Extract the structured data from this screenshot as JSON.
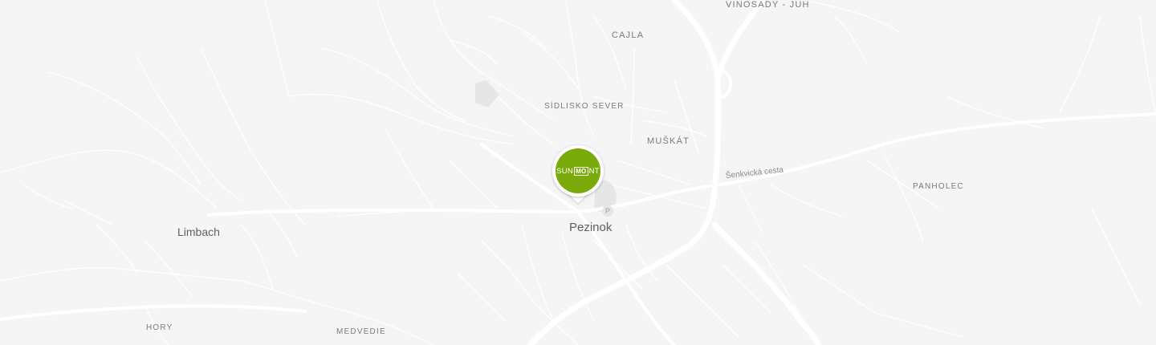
{
  "map": {
    "colors": {
      "background": "#f5f5f5",
      "road": "#ffffff",
      "building": "#e6e6e6",
      "marker": "#7aab0a"
    },
    "labels": {
      "vinosady": "VINOSADY - JUH",
      "cajla": "CAJLA",
      "sidlisko": "SÍDLISKO SEVER",
      "muskat": "MUŠKÁT",
      "pezinok": "Pezinok",
      "limbach": "Limbach",
      "panholec": "PANHOLEC",
      "hory": "HORY",
      "medvedie": "MEDVEDIE",
      "senkvicka": "Šenkvická cesta"
    },
    "marker": {
      "brand_pre": "SUN",
      "brand_box": "MO",
      "brand_post": "NT",
      "icon": "map-pin-icon"
    },
    "parking_icon": {
      "name": "parking-icon",
      "symbol": "P"
    }
  }
}
